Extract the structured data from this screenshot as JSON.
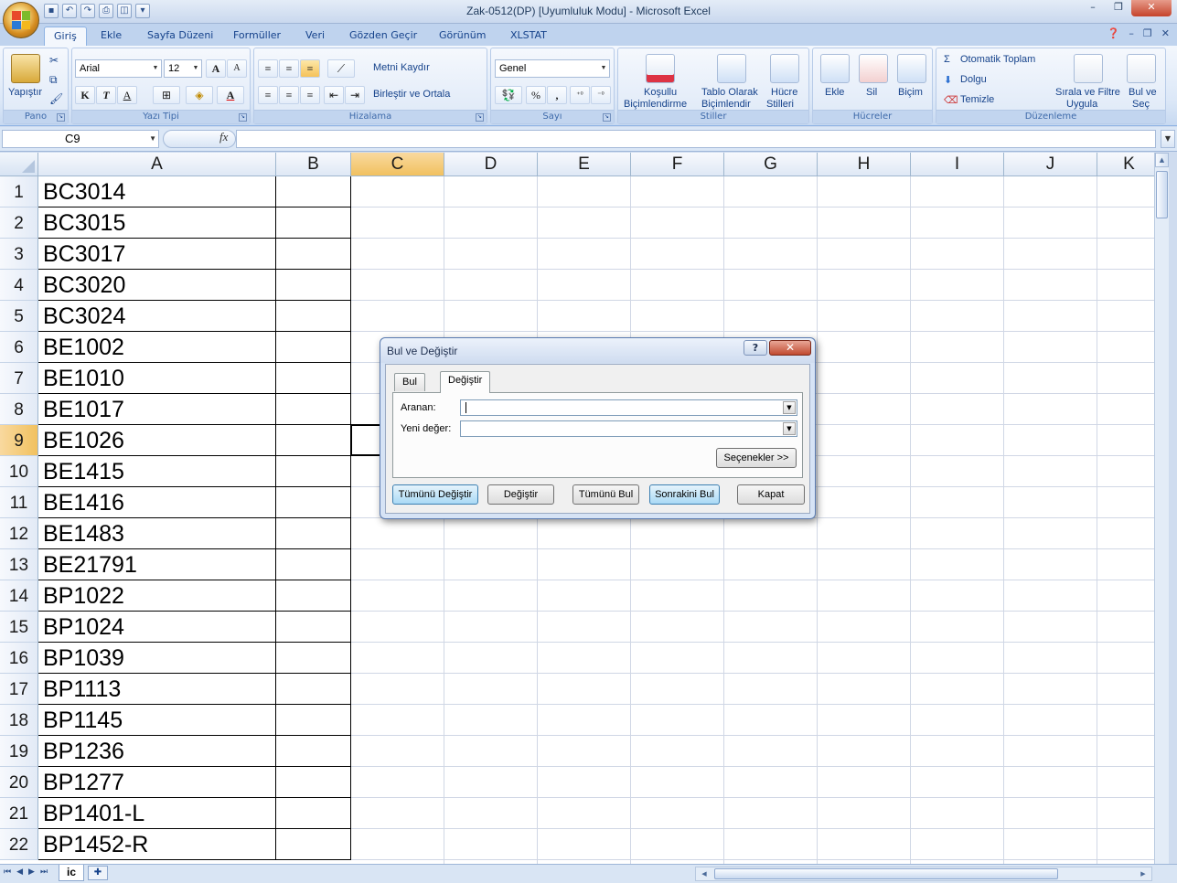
{
  "window": {
    "title": "Zak-0512(DP)  [Uyumluluk Modu] - Microsoft Excel",
    "min": "–",
    "max": "❐",
    "close": "✕"
  },
  "ribbon_tabs": [
    "Giriş",
    "Ekle",
    "Sayfa Düzeni",
    "Formüller",
    "Veri",
    "Gözden Geçir",
    "Görünüm",
    "XLSTAT"
  ],
  "ribbon": {
    "pano": {
      "title": "Pano",
      "paste": "Yapıştır"
    },
    "yazi_tipi": {
      "title": "Yazı Tipi",
      "font": "Arial",
      "size": "12",
      "bold": "K",
      "italic": "T",
      "underline": "A"
    },
    "hizalama": {
      "title": "Hizalama",
      "wrap": "Metni Kaydır",
      "merge": "Birleştir ve Ortala"
    },
    "sayi": {
      "title": "Sayı",
      "format": "Genel",
      "percent": "%",
      "comma": ","
    },
    "stiller": {
      "title": "Stiller",
      "conditional": "Koşullu",
      "conditional2": "Biçimlendirme",
      "table": "Tablo Olarak",
      "table2": "Biçimlendir",
      "cell": "Hücre",
      "cell2": "Stilleri"
    },
    "hucreler": {
      "title": "Hücreler",
      "insert": "Ekle",
      "delete": "Sil",
      "format": "Biçim"
    },
    "duzenleme": {
      "title": "Düzenleme",
      "autosum": "Otomatik Toplam",
      "fill": "Dolgu",
      "clear": "Temizle",
      "sort": "Sırala ve Filtre",
      "sort2": "Uygula",
      "find": "Bul ve",
      "find2": "Seç"
    }
  },
  "formula_bar": {
    "name_box": "C9",
    "fx": "fx",
    "value": ""
  },
  "columns": [
    "A",
    "B",
    "C",
    "D",
    "E",
    "F",
    "G",
    "H",
    "I",
    "J",
    "K"
  ],
  "selected_column": "C",
  "selected_row": 9,
  "rows": [
    {
      "n": "1",
      "a": "BC3014"
    },
    {
      "n": "2",
      "a": "BC3015"
    },
    {
      "n": "3",
      "a": "BC3017"
    },
    {
      "n": "4",
      "a": "BC3020"
    },
    {
      "n": "5",
      "a": "BC3024"
    },
    {
      "n": "6",
      "a": "BE1002"
    },
    {
      "n": "7",
      "a": "BE1010"
    },
    {
      "n": "8",
      "a": "BE1017"
    },
    {
      "n": "9",
      "a": "BE1026"
    },
    {
      "n": "10",
      "a": "BE1415"
    },
    {
      "n": "11",
      "a": "BE1416"
    },
    {
      "n": "12",
      "a": "BE1483"
    },
    {
      "n": "13",
      "a": "BE21791"
    },
    {
      "n": "14",
      "a": "BP1022"
    },
    {
      "n": "15",
      "a": "BP1024"
    },
    {
      "n": "16",
      "a": "BP1039"
    },
    {
      "n": "17",
      "a": "BP1113"
    },
    {
      "n": "18",
      "a": "BP1145"
    },
    {
      "n": "19",
      "a": "BP1236"
    },
    {
      "n": "20",
      "a": "BP1277"
    },
    {
      "n": "21",
      "a": "BP1401-L"
    },
    {
      "n": "22",
      "a": "BP1452-R"
    }
  ],
  "sheet_tab": "ic",
  "dialog": {
    "title": "Bul ve Değiştir",
    "help": "?",
    "close": "✕",
    "tab_find": "Bul",
    "tab_replace": "Değiştir",
    "find_label": "Aranan:",
    "find_value": "",
    "replace_label": "Yeni değer:",
    "replace_value": "",
    "options": "Seçenekler >>",
    "replace_all": "Tümünü Değiştir",
    "replace": "Değiştir",
    "find_all": "Tümünü Bul",
    "find_next": "Sonrakini Bul",
    "close_btn": "Kapat"
  }
}
